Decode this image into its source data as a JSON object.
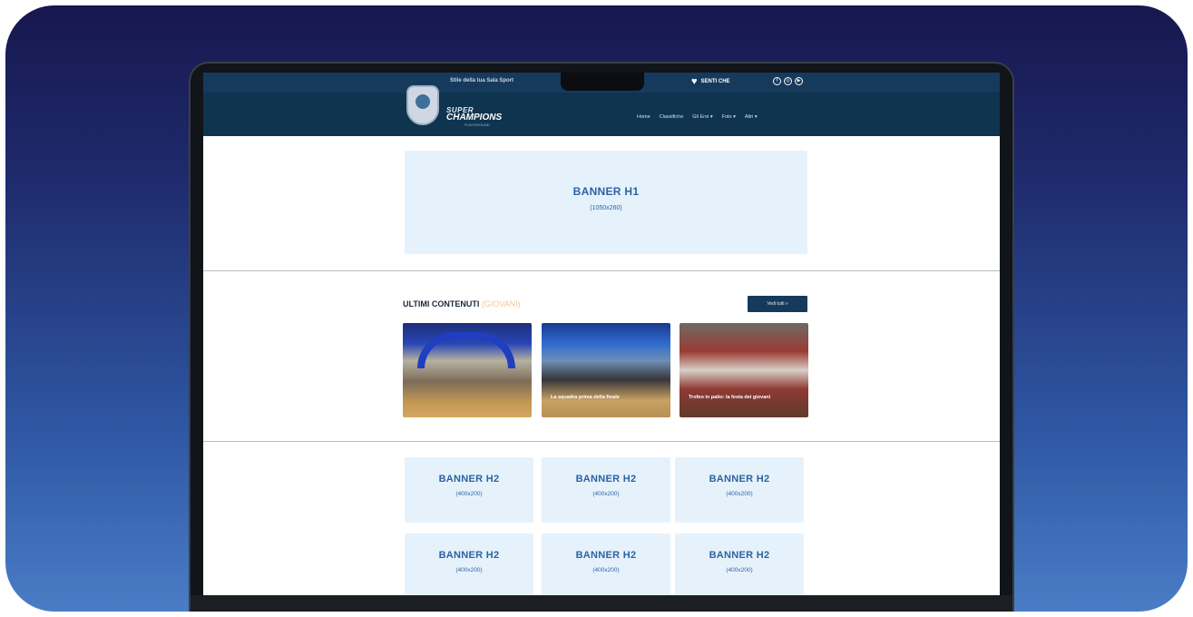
{
  "site": {
    "topbar_text": "Stile della tua Sala Sport",
    "hearts_label": "SENTI CHE",
    "brand_line1": "SUPER",
    "brand_line2": "CHAMPIONS",
    "brand_line3": "PLAYGROUND",
    "nav": [
      "Home",
      "Classifiche",
      "Gli Eroi ▾",
      "Foto ▾",
      "Altri ▾"
    ]
  },
  "banner_h1": {
    "title": "BANNER H1",
    "size": "(1050x260)"
  },
  "latest": {
    "title": "ULTIMI CONTENUTI",
    "subtitle": "(GIOVANI)",
    "all_button": "Vedi tutti »",
    "items": [
      {
        "caption": ""
      },
      {
        "caption": "La squadra prima della finale"
      },
      {
        "caption": "Trofeo in palio: la festa dei giovani"
      }
    ]
  },
  "banners_h2": [
    {
      "title": "BANNER H2",
      "size": "(400x200)"
    },
    {
      "title": "BANNER H2",
      "size": "(400x200)"
    },
    {
      "title": "BANNER H2",
      "size": "(400x200)"
    },
    {
      "title": "BANNER H2",
      "size": "(400x200)"
    },
    {
      "title": "BANNER H2",
      "size": "(400x200)"
    },
    {
      "title": "BANNER H2",
      "size": "(400x200)"
    }
  ]
}
